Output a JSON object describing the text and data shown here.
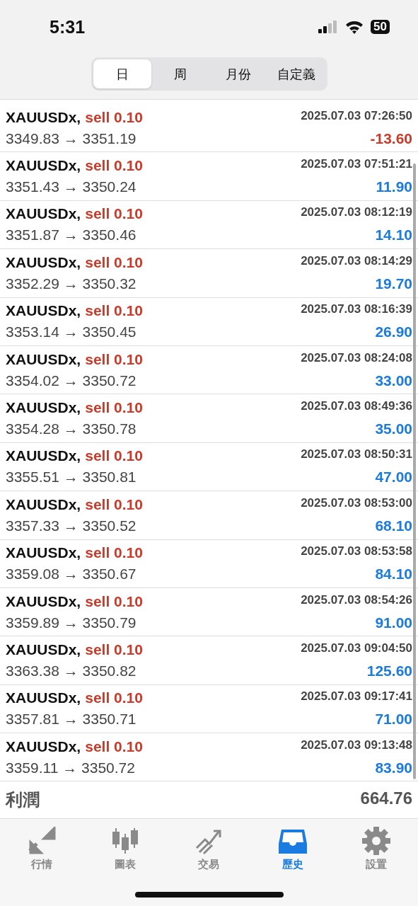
{
  "status_bar": {
    "time": "5:31",
    "battery": "50"
  },
  "tabs": [
    {
      "label": "日",
      "selected": true
    },
    {
      "label": "周",
      "selected": false
    },
    {
      "label": "月份",
      "selected": false
    },
    {
      "label": "自定義",
      "selected": false
    }
  ],
  "deals": [
    {
      "symbol": "XAUUSDx,",
      "side": "sell 0.10",
      "time": "2025.07.03 07:26:50",
      "prices": "3349.83 → 3351.19",
      "profit": "-13.60",
      "color": "#cc3a2a"
    },
    {
      "symbol": "XAUUSDx,",
      "side": "sell 0.10",
      "time": "2025.07.03 07:51:21",
      "prices": "3351.43 → 3350.24",
      "profit": "11.90",
      "color": "#1a7be0"
    },
    {
      "symbol": "XAUUSDx,",
      "side": "sell 0.10",
      "time": "2025.07.03 08:12:19",
      "prices": "3351.87 → 3350.46",
      "profit": "14.10",
      "color": "#1a7be0"
    },
    {
      "symbol": "XAUUSDx,",
      "side": "sell 0.10",
      "time": "2025.07.03 08:14:29",
      "prices": "3352.29 → 3350.32",
      "profit": "19.70",
      "color": "#1a7be0"
    },
    {
      "symbol": "XAUUSDx,",
      "side": "sell 0.10",
      "time": "2025.07.03 08:16:39",
      "prices": "3353.14 → 3350.45",
      "profit": "26.90",
      "color": "#1a7be0"
    },
    {
      "symbol": "XAUUSDx,",
      "side": "sell 0.10",
      "time": "2025.07.03 08:24:08",
      "prices": "3354.02 → 3350.72",
      "profit": "33.00",
      "color": "#1a7be0"
    },
    {
      "symbol": "XAUUSDx,",
      "side": "sell 0.10",
      "time": "2025.07.03 08:49:36",
      "prices": "3354.28 → 3350.78",
      "profit": "35.00",
      "color": "#1a7be0"
    },
    {
      "symbol": "XAUUSDx,",
      "side": "sell 0.10",
      "time": "2025.07.03 08:50:31",
      "prices": "3355.51 → 3350.81",
      "profit": "47.00",
      "color": "#1a7be0"
    },
    {
      "symbol": "XAUUSDx,",
      "side": "sell 0.10",
      "time": "2025.07.03 08:53:00",
      "prices": "3357.33 → 3350.52",
      "profit": "68.10",
      "color": "#1a7be0"
    },
    {
      "symbol": "XAUUSDx,",
      "side": "sell 0.10",
      "time": "2025.07.03 08:53:58",
      "prices": "3359.08 → 3350.67",
      "profit": "84.10",
      "color": "#1a7be0"
    },
    {
      "symbol": "XAUUSDx,",
      "side": "sell 0.10",
      "time": "2025.07.03 08:54:26",
      "prices": "3359.89 → 3350.79",
      "profit": "91.00",
      "color": "#1a7be0"
    },
    {
      "symbol": "XAUUSDx,",
      "side": "sell 0.10",
      "time": "2025.07.03 09:04:50",
      "prices": "3363.38 → 3350.82",
      "profit": "125.60",
      "color": "#1a7be0"
    },
    {
      "symbol": "XAUUSDx,",
      "side": "sell 0.10",
      "time": "2025.07.03 09:17:41",
      "prices": "3357.81 → 3350.71",
      "profit": "71.00",
      "color": "#1a7be0"
    },
    {
      "symbol": "XAUUSDx,",
      "side": "sell 0.10",
      "time": "2025.07.03 09:13:48",
      "prices": "3359.11 → 3350.72",
      "profit": "83.90",
      "color": "#1a7be0"
    }
  ],
  "summary": {
    "label": "利潤",
    "value": "664.76"
  },
  "nav": [
    {
      "label": "行情",
      "selected": false
    },
    {
      "label": "圖表",
      "selected": false
    },
    {
      "label": "交易",
      "selected": false
    },
    {
      "label": "歷史",
      "selected": true
    },
    {
      "label": "設置",
      "selected": false
    }
  ]
}
